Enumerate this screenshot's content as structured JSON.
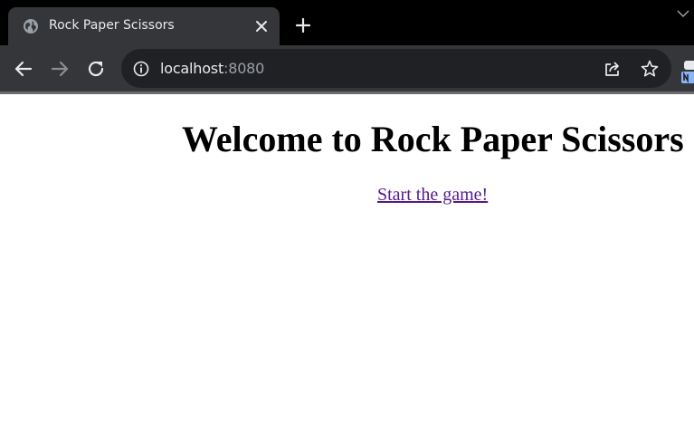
{
  "browser": {
    "tab": {
      "title": "Rock Paper Scissors",
      "favicon": "globe-icon",
      "close_icon": "close-icon"
    },
    "new_tab_icon": "plus-icon",
    "toolbar": {
      "back_icon": "back-arrow-icon",
      "forward_icon": "forward-arrow-icon",
      "reload_icon": "reload-icon",
      "url_host": "localhost",
      "url_port": ":8080",
      "info_icon": "info-icon",
      "share_icon": "share-icon",
      "bookmark_icon": "star-icon"
    },
    "colors": {
      "tabstrip": "#000000",
      "tab": "#35363a",
      "omnibox": "#202124",
      "text": "#e8eaed",
      "muted": "#9aa0a6"
    }
  },
  "page": {
    "heading": "Welcome to Rock Paper Scissors",
    "link_text": "Start the game!",
    "link_color": "#551a8b"
  }
}
